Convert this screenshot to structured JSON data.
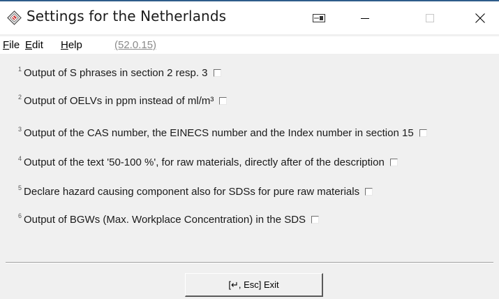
{
  "window": {
    "title": "Settings for the Netherlands"
  },
  "menu": {
    "file_first": "F",
    "file_rest": "ile",
    "edit_first": "E",
    "edit_rest": "dit",
    "help_first": "H",
    "help_rest": "elp",
    "version": "(52.0.15)"
  },
  "options": [
    {
      "num": "1",
      "label": "Output of S phrases in section 2 resp. 3",
      "checked": false
    },
    {
      "num": "2",
      "label": "Output of OELVs in ppm instead of ml/m³",
      "checked": false
    },
    {
      "num": "3",
      "label": "Output of the CAS number, the EINECS number and the Index number in section 15",
      "checked": false
    },
    {
      "num": "4",
      "label": "Output of the text '50-100 %', for raw materials, directly after of the description",
      "checked": false
    },
    {
      "num": "5",
      "label": "Declare hazard causing component also for SDSs for pure raw materials",
      "checked": false
    },
    {
      "num": "6",
      "label": "Output of BGWs (Max. Workplace Concentration) in the SDS",
      "checked": false
    }
  ],
  "footer": {
    "exit_label": "[↵, Esc] Exit"
  },
  "icons": {
    "app": "app-diamond-icon",
    "pin": "window-pin-icon",
    "minimize": "minimize-icon",
    "maximize": "maximize-icon",
    "close": "close-icon"
  }
}
